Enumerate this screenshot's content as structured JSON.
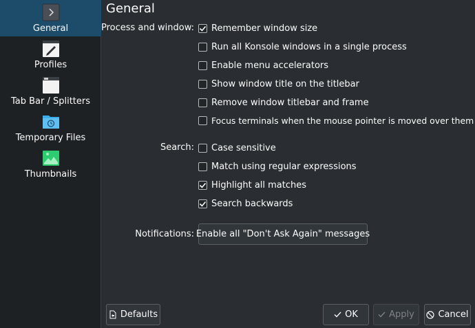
{
  "sidebar": {
    "items": [
      {
        "label": "General",
        "icon": "chevron-right-icon",
        "active": true
      },
      {
        "label": "Profiles",
        "icon": "pen-icon"
      },
      {
        "label": "Tab Bar / Splitters",
        "icon": "window-icon"
      },
      {
        "label": "Temporary Files",
        "icon": "folder-clock-icon"
      },
      {
        "label": "Thumbnails",
        "icon": "image-icon"
      }
    ]
  },
  "main": {
    "title": "General",
    "process_section": {
      "label": "Process and window:",
      "options": [
        {
          "label": "Remember window size",
          "checked": true
        },
        {
          "label": "Run all Konsole windows in a single process",
          "checked": false
        },
        {
          "label": "Enable menu accelerators",
          "checked": false
        },
        {
          "label": "Show window title on the titlebar",
          "checked": false
        },
        {
          "label": "Remove window titlebar and frame",
          "checked": false
        },
        {
          "label": "Focus terminals when the mouse pointer is moved over them",
          "checked": false
        }
      ]
    },
    "search_section": {
      "label": "Search:",
      "options": [
        {
          "label": "Case sensitive",
          "checked": false
        },
        {
          "label": "Match using regular expressions",
          "checked": false
        },
        {
          "label": "Highlight all matches",
          "checked": true
        },
        {
          "label": "Search backwards",
          "checked": true
        }
      ]
    },
    "notifications": {
      "label": "Notifications:",
      "button_label": "Enable all \"Don't Ask Again\" messages"
    }
  },
  "footer": {
    "defaults_label": "Defaults",
    "ok_label": "OK",
    "apply_label": "Apply",
    "cancel_label": "Cancel"
  },
  "colors": {
    "sidebar_active": "#1d4c6a",
    "background": "#2a2e32",
    "accent": "#3daee9"
  }
}
